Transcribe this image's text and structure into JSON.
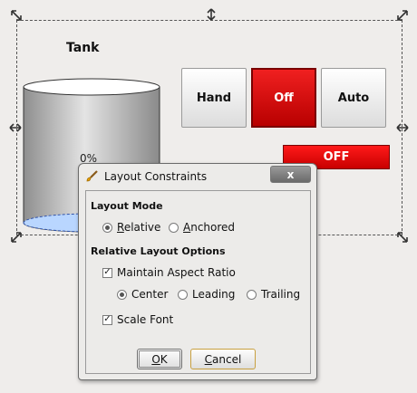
{
  "tank": {
    "title": "Tank",
    "percent": "0%"
  },
  "mode_buttons": {
    "hand": "Hand",
    "off": "Off",
    "auto": "Auto"
  },
  "status": {
    "label": "OFF"
  },
  "colors": {
    "accent_red": "#d40000",
    "tank_fill": "#b9d6ff"
  },
  "dialog": {
    "title": "Layout Constraints",
    "close_label": "x",
    "layout_mode": {
      "heading": "Layout Mode",
      "options": [
        {
          "first": "R",
          "rest": "elative",
          "selected": true
        },
        {
          "first": "A",
          "rest": "nchored",
          "selected": false
        }
      ]
    },
    "relative_options": {
      "heading": "Relative Layout Options",
      "maintain_aspect": {
        "label": "Maintain Aspect Ratio",
        "checked": true
      },
      "alignment": [
        {
          "label": "Center",
          "selected": true
        },
        {
          "label": "Leading",
          "selected": false
        },
        {
          "label": "Trailing",
          "selected": false
        }
      ],
      "scale_font": {
        "label": "Scale Font",
        "checked": true
      }
    },
    "buttons": {
      "ok_first": "O",
      "ok_rest": "K",
      "cancel_first": "C",
      "cancel_rest": "ancel"
    }
  }
}
